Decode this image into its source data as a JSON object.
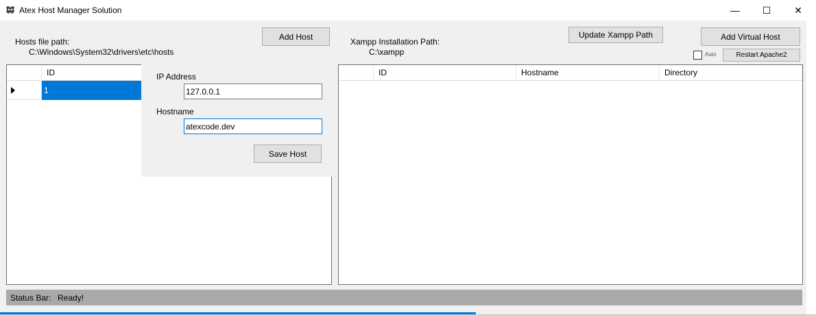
{
  "window": {
    "title": "Atex Host Manager Solution",
    "minimize_glyph": "—",
    "maximize_glyph": "☐",
    "close_glyph": "✕"
  },
  "hosts_panel": {
    "path_label": "Hosts file path:",
    "path_value": "C:\\Windows\\System32\\drivers\\etc\\hosts",
    "add_host_label": "Add Host",
    "grid": {
      "columns": [
        "ID"
      ],
      "rows": [
        {
          "id": "1",
          "selected": true
        }
      ]
    }
  },
  "host_editor": {
    "ip_label": "IP Address",
    "ip_value": "127.0.0.1",
    "hostname_label": "Hostname",
    "hostname_value": "atexcode.dev",
    "save_label": "Save Host"
  },
  "xampp_panel": {
    "path_label": "Xampp Installation Path:",
    "path_value": "C:\\xampp",
    "update_label": "Update Xampp Path",
    "add_vhost_label": "Add Virtual Host",
    "auto_label": "Auto",
    "auto_checked": false,
    "restart_label": "Restart Apache2",
    "grid": {
      "columns": [
        "ID",
        "Hostname",
        "Directory"
      ],
      "rows": []
    }
  },
  "status_bar": {
    "label": "Status Bar:",
    "message": "Ready!"
  },
  "colors": {
    "selection": "#0078d7",
    "status_bar_bg": "#a9a9a9",
    "client_bg": "#f0f0f0"
  }
}
